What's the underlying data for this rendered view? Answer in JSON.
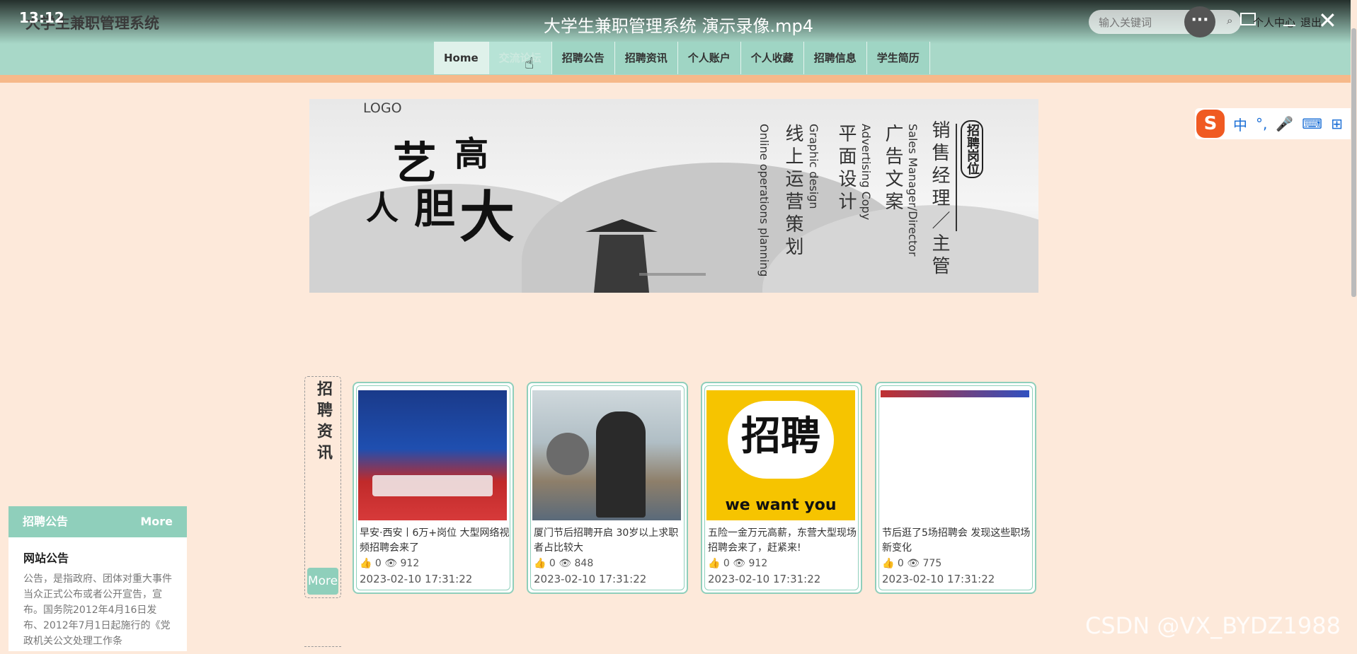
{
  "video": {
    "clock": "13:12",
    "title": "大学生兼职管理系统 演示录像.mp4",
    "more": "···"
  },
  "site": {
    "title": "大学生兼职管理系统"
  },
  "header": {
    "search_placeholder": "输入关键词",
    "personal": "个人中心",
    "logout": "退出"
  },
  "nav": [
    "Home",
    "交流论坛",
    "招聘公告",
    "招聘资讯",
    "个人账户",
    "个人收藏",
    "招聘信息",
    "学生简历"
  ],
  "banner": {
    "logo": "LOGO",
    "calli": [
      "艺",
      "高",
      "人",
      "胆",
      "大"
    ],
    "badge": "招聘岗位",
    "cols": [
      {
        "text": "销售经理／主管"
      },
      {
        "text": "Sales Manager/Director"
      },
      {
        "text": "广告文案"
      },
      {
        "text": "Advertising Copy"
      },
      {
        "text": "平面设计"
      },
      {
        "text": "Graphic design"
      },
      {
        "text": "线上运营策划"
      },
      {
        "text": "Online operations planning"
      }
    ]
  },
  "ime": {
    "logo": "S",
    "items": [
      "中",
      "°,",
      "🎤",
      "⌨",
      "⊞"
    ]
  },
  "section": {
    "label": "招聘资讯",
    "more": "More"
  },
  "cards": [
    {
      "title": "早安·西安丨6万+岗位 大型网络视频招聘会来了",
      "likes": "0",
      "views": "912",
      "date": "2023-02-10 17:31:22"
    },
    {
      "title": "厦门节后招聘开启 30岁以上求职者占比较大",
      "likes": "0",
      "views": "848",
      "date": "2023-02-10 17:31:22"
    },
    {
      "title": "五险一金万元高薪，东营大型现场招聘会来了，赶紧来!",
      "likes": "0",
      "views": "912",
      "date": "2023-02-10 17:31:22",
      "img_text": "招聘",
      "img_sub": "we want you"
    },
    {
      "title": "节后逛了5场招聘会 发现这些职场新变化",
      "likes": "0",
      "views": "775",
      "date": "2023-02-10 17:31:22"
    }
  ],
  "notice": {
    "head": "招聘公告",
    "more": "More",
    "item_title": "网站公告",
    "item_body": "公告，是指政府、团体对重大事件当众正式公布或者公开宣告，宣布。国务院2012年4月16日发布、2012年7月1日起施行的《党政机关公文处理工作条"
  },
  "watermark": "CSDN @VX_BYDZ1988"
}
